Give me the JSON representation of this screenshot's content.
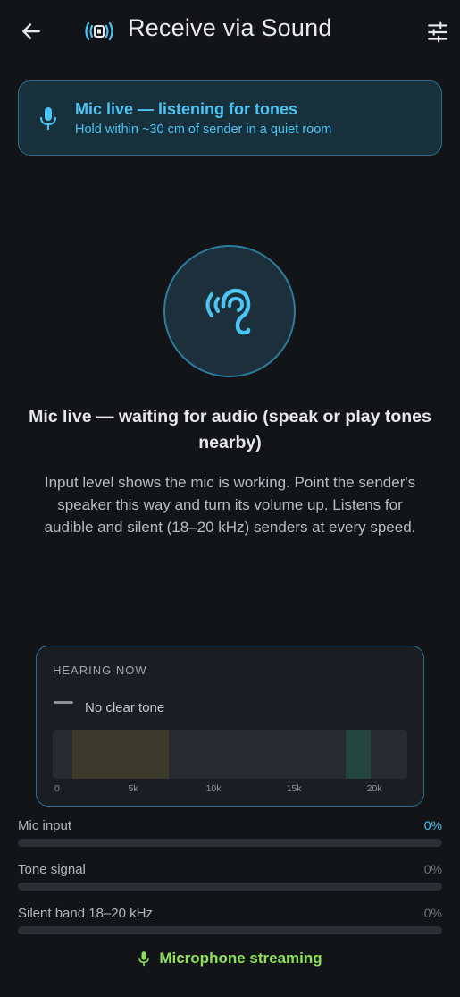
{
  "header": {
    "title": "Receive via Sound",
    "back_icon": "arrow-left-icon",
    "title_icon": "sound-broadcast-icon",
    "settings_icon": "tune-sliders-icon"
  },
  "banner": {
    "title": "Mic live — listening for tones",
    "subtitle": "Hold within ~30 cm of sender in a quiet room",
    "icon": "microphone-icon"
  },
  "status": {
    "icon": "hearing-ear-icon",
    "title": "Mic live — waiting for audio (speak or play tones nearby)",
    "body": "Input level shows the mic is working. Point the sender's speaker this way and turn its volume up. Listens for audible and silent (18–20 kHz) senders at every speed."
  },
  "hearing_now": {
    "label": "HEARING NOW",
    "tone": "No clear tone",
    "axis_ticks": [
      {
        "label": "0",
        "hz": 0
      },
      {
        "label": "5k",
        "hz": 5000
      },
      {
        "label": "10k",
        "hz": 10000
      },
      {
        "label": "15k",
        "hz": 15000
      },
      {
        "label": "20k",
        "hz": 20000
      }
    ],
    "range_hz": [
      0,
      22050
    ],
    "bands": [
      {
        "name": "audible-band",
        "from_hz": 1200,
        "to_hz": 7200,
        "color": "#3b3a2b"
      },
      {
        "name": "silent-band",
        "from_hz": 18200,
        "to_hz": 19800,
        "color": "#24463f"
      }
    ]
  },
  "meters": [
    {
      "name": "mic-input",
      "label": "Mic input",
      "value": "0%",
      "level": 0,
      "active": true
    },
    {
      "name": "tone-signal",
      "label": "Tone signal",
      "value": "0%",
      "level": 0,
      "active": false
    },
    {
      "name": "silent-band",
      "label": "Silent band 18–20 kHz",
      "value": "0%",
      "level": 0,
      "active": false
    }
  ],
  "footer": {
    "status": "Microphone streaming",
    "icon": "microphone-icon"
  },
  "colors": {
    "accent": "#4cc4f3",
    "streaming": "#8ee05a",
    "background": "#131418"
  }
}
